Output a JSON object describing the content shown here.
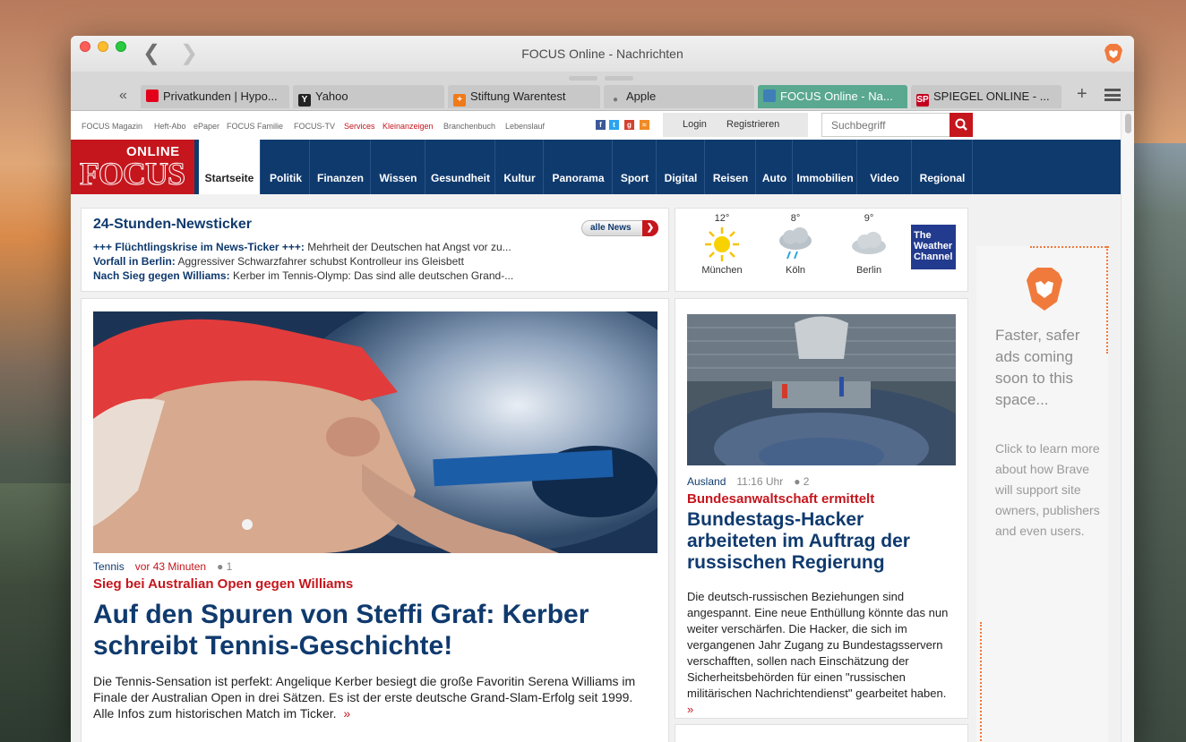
{
  "window": {
    "title": "FOCUS Online - Nachrichten"
  },
  "tabs": [
    {
      "label": "Privatkunden | Hypo...",
      "favicon": "unicredit-icon"
    },
    {
      "label": "Yahoo",
      "favicon": "yahoo-icon"
    },
    {
      "label": "Stiftung Warentest",
      "favicon": "warentest-icon"
    },
    {
      "label": "Apple",
      "favicon": "apple-icon"
    },
    {
      "label": "FOCUS Online - Na...",
      "favicon": "focus-icon",
      "active": true
    },
    {
      "label": "SPIEGEL ONLINE - ...",
      "favicon": "spiegel-icon"
    }
  ],
  "topnav": {
    "links": [
      "FOCUS Magazin",
      "Heft-Abo",
      "ePaper",
      "FOCUS Familie",
      "FOCUS-TV",
      "Services",
      "Kleinanzeigen",
      "Branchenbuch",
      "Lebenslauf"
    ],
    "social": [
      "facebook-icon",
      "twitter-icon",
      "google-plus-icon",
      "rss-icon"
    ],
    "login": "Login",
    "register": "Registrieren",
    "search_placeholder": "Suchbegriff"
  },
  "logo": {
    "online": "ONLINE",
    "focus": "FOCUS"
  },
  "mainnav": [
    "Startseite",
    "Politik",
    "Finanzen",
    "Wissen",
    "Gesundheit",
    "Kultur",
    "Panorama",
    "Sport",
    "Digital",
    "Reisen",
    "Auto",
    "Immobilien",
    "Video",
    "Regional"
  ],
  "ticker": {
    "title": "24-Stunden-Newsticker",
    "button": "alle News",
    "items": [
      {
        "bold": "+++ Flüchtlingskrise im News-Ticker +++:",
        "text": " Mehrheit der Deutschen hat Angst vor zu..."
      },
      {
        "bold": "Vorfall in Berlin:",
        "text": " Aggressiver Schwarzfahrer schubst Kontrolleur ins Gleisbett"
      },
      {
        "bold": "Nach Sieg gegen Williams:",
        "text": " Kerber im Tennis-Olymp: Das sind alle deutschen Grand-..."
      }
    ]
  },
  "weather": [
    {
      "temp": "12°",
      "city": "München",
      "icon": "sun-icon"
    },
    {
      "temp": "8°",
      "city": "Köln",
      "icon": "rain-cloud-icon"
    },
    {
      "temp": "9°",
      "city": "Berlin",
      "icon": "cloud-icon"
    }
  ],
  "weather_logo": "The Weather Channel",
  "hero": {
    "category": "Tennis",
    "time": "vor 43 Minuten",
    "comments": "1",
    "kicker": "Sieg bei Australian Open gegen Williams",
    "headline": "Auf den Spuren von Steffi Graf: Kerber schreibt Tennis-Geschichte!",
    "teaser": "Die Tennis-Sensation ist perfekt: Angelique Kerber besiegt die große Favoritin Serena Williams im Finale der Australian Open in drei Sätzen. Es ist der erste deutsche Grand-Slam-Erfolg seit 1999. Alle Infos zum historischen Match im Ticker.",
    "more": "»"
  },
  "side": {
    "category": "Ausland",
    "time": "11:16 Uhr",
    "comments": "2",
    "kicker": "Bundesanwaltschaft ermittelt",
    "headline": "Bundestags-Hacker arbeiteten im Auftrag der russischen Regierung",
    "teaser": "Die deutsch-russischen Beziehungen sind angespannt. Eine neue Enthüllung könnte das nun weiter verschärfen. Die Hacker, die sich im vergangenen Jahr Zugang zu Bundestagsservern verschafften, sollen nach Einschätzung der Sicherheitsbehörden für einen \"russischen militärischen Nachrichtendienst\" gearbeitet haben.",
    "more": "»"
  },
  "ad": {
    "title": "Faster, safer ads coming soon to this space...",
    "text": "Click to learn more about how Brave will support site owners, publishers and even users."
  },
  "colors": {
    "focus_blue": "#0f3a6e",
    "focus_red": "#c5161d",
    "brave_orange": "#f07a3c",
    "active_tab": "#5aa890"
  }
}
